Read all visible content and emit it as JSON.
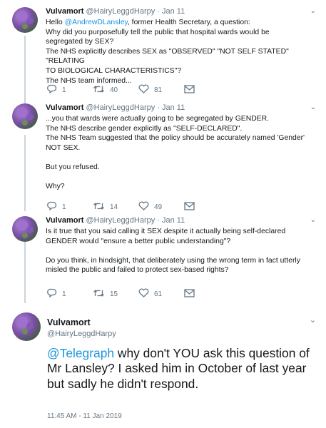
{
  "tweets": [
    {
      "name": "Vulvamort",
      "handle": "@HairyLeggdHarpy",
      "sep": "·",
      "date": "Jan 11",
      "greeting": "Hello ",
      "mention": "@AndrewDLansley",
      "greeting_rest": ", former Health Secretary, a question:",
      "lines": [
        "Why did you purposefully tell the public that hospital wards would be",
        "segregated by SEX?",
        "The NHS explicitly describes SEX as \"OBSERVED\" \"NOT SELF STATED\" \"RELATING",
        "TO BIOLOGICAL CHARACTERISTICS\"?",
        "The NHS team informed..."
      ],
      "replies": "1",
      "retweets": "40",
      "likes": "81"
    },
    {
      "name": "Vulvamort",
      "handle": "@HairyLeggdHarpy",
      "sep": "·",
      "date": "Jan 11",
      "lines": [
        "...you that wards were actually going to be segregated by GENDER.",
        "The NHS describe gender explicitly as \"SELF-DECLARED\".",
        "The NHS Team suggested that the policy should be accurately named 'Gender'",
        "NOT SEX."
      ],
      "line_refused": "But you refused.",
      "line_why": "Why?",
      "replies": "1",
      "retweets": "14",
      "likes": "49"
    },
    {
      "name": "Vulvamort",
      "handle": "@HairyLeggdHarpy",
      "sep": "·",
      "date": "Jan 11",
      "lines": [
        "Is it true that you said calling it SEX despite it actually being self-declared",
        "GENDER would \"ensure a better public understanding\"?"
      ],
      "lines2": [
        "Do you think, in hindsight, that deliberately using the wrong term in fact utterly",
        "misled the public and failed to protect sex-based rights?"
      ],
      "replies": "1",
      "retweets": "15",
      "likes": "61"
    }
  ],
  "main": {
    "name": "Vulvamort",
    "handle": "@HairyLeggdHarpy",
    "mention": "@Telegraph",
    "text": " why don't YOU ask this question of Mr Lansley? I asked him in October of last year but sadly he didn't respond.",
    "timestamp": "11:45 AM - 11 Jan 2019"
  },
  "icons": {
    "reply": "reply-icon",
    "retweet": "retweet-icon",
    "like": "heart-icon",
    "message": "envelope-icon",
    "caret": "chevron-down-icon"
  },
  "colors": {
    "link": "#1b95e0",
    "muted": "#657786",
    "text": "#14171a",
    "thread_line": "#ccd6dd"
  }
}
